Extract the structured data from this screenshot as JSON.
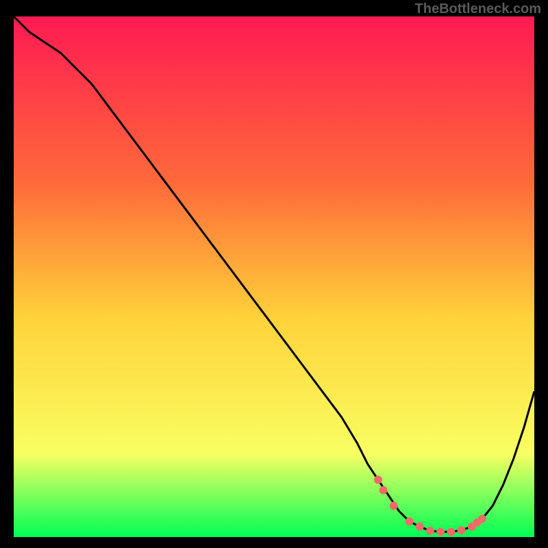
{
  "watermark": "TheBottleneck.com",
  "colors": {
    "background": "#000000",
    "gradient_top": "#ff1a52",
    "gradient_mid1": "#ff6a3a",
    "gradient_mid2": "#ffd23a",
    "gradient_mid3": "#f8ff62",
    "gradient_bottom": "#00ff55",
    "curve": "#000000",
    "marker": "#f06a6a",
    "watermark_text": "#5a5a5a"
  },
  "chart_data": {
    "type": "line",
    "title": "",
    "xlabel": "",
    "ylabel": "",
    "xlim": [
      0,
      100
    ],
    "ylim": [
      0,
      100
    ],
    "series": [
      {
        "name": "bottleneck-curve",
        "x": [
          0,
          3,
          6,
          9,
          12,
          15,
          18,
          21,
          24,
          27,
          30,
          33,
          36,
          39,
          42,
          45,
          48,
          51,
          54,
          57,
          60,
          63,
          66,
          68,
          70,
          72,
          74,
          76,
          78,
          80,
          82,
          84,
          86,
          88,
          90,
          92,
          94,
          96,
          98,
          100
        ],
        "y": [
          100,
          97,
          95,
          93,
          90,
          87,
          83,
          79,
          75,
          71,
          67,
          63,
          59,
          55,
          51,
          47,
          43,
          39,
          35,
          31,
          27,
          23,
          18,
          14,
          11,
          8,
          5,
          3,
          2,
          1.2,
          1,
          1,
          1.3,
          2,
          3.5,
          6,
          10,
          15,
          21,
          28
        ]
      }
    ],
    "markers": {
      "name": "highlight-points",
      "x": [
        70,
        71,
        73,
        76,
        78,
        80,
        82,
        84,
        86,
        88,
        89,
        90
      ],
      "y": [
        11,
        9,
        6,
        3,
        2,
        1.2,
        1,
        1,
        1.3,
        2,
        2.8,
        3.5
      ]
    }
  }
}
